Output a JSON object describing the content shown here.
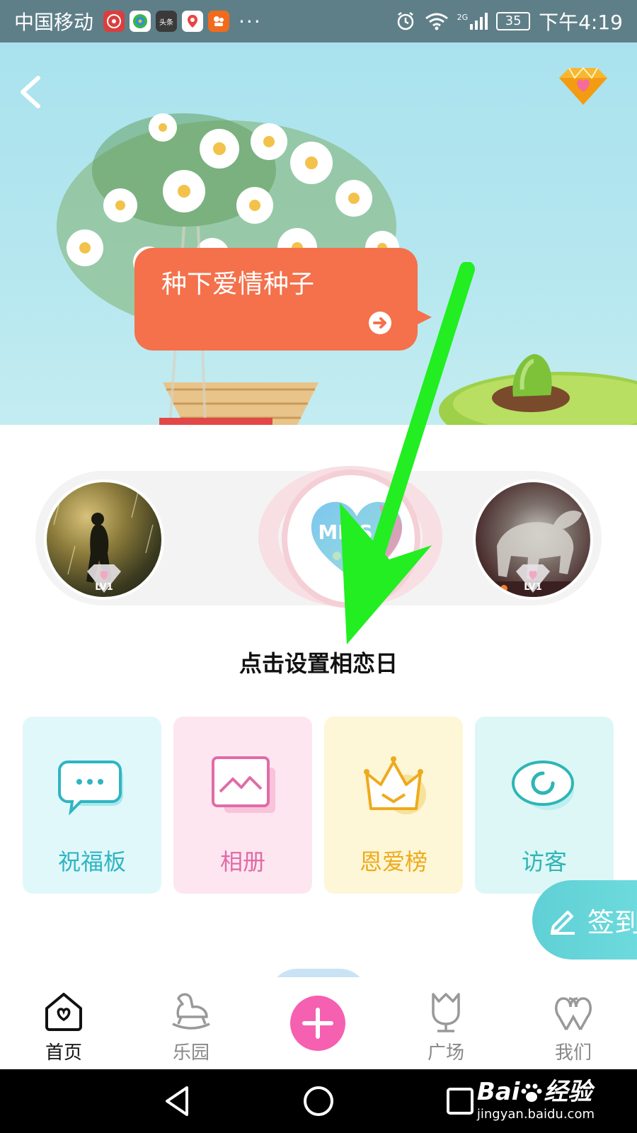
{
  "status_bar": {
    "carrier": "中国移动",
    "app_icons": [
      {
        "name": "app-icon-1",
        "color": "#d93f3f",
        "text": ""
      },
      {
        "name": "app-icon-2",
        "color": "#ffffff",
        "text": ""
      },
      {
        "name": "toutiao-icon",
        "color": "#3a3a3a",
        "text": "头条"
      },
      {
        "name": "app-icon-4",
        "color": "#e84545",
        "text": ""
      },
      {
        "name": "app-icon-5",
        "color": "#f26b1d",
        "text": ""
      }
    ],
    "more": "···",
    "network": "2G",
    "battery": "35",
    "time": "下午4:19"
  },
  "hero": {
    "bubble_text": "种下爱情种子",
    "colors": {
      "sky": "#a9e2ee",
      "bubble": "#f4714b"
    }
  },
  "couple": {
    "left_level": "LV1",
    "right_level": "LV1",
    "center_text": "MISS"
  },
  "anniversary_label": "点击设置相恋日",
  "features": [
    {
      "label": "祝福板",
      "icon": "chat-bubble-icon",
      "color": "#2fb5c2"
    },
    {
      "label": "相册",
      "icon": "photo-album-icon",
      "color": "#e06ca7"
    },
    {
      "label": "恩爱榜",
      "icon": "crown-icon",
      "color": "#eeaa1c"
    },
    {
      "label": "访客",
      "icon": "eye-icon",
      "color": "#2fb5b5"
    }
  ],
  "checkin_label": "签到",
  "tabs": {
    "home": "首页",
    "park": "乐园",
    "square": "广场",
    "us": "我们"
  },
  "watermark": {
    "main": "Bai",
    "main2": "经验",
    "sub": "jingyan.baidu.com"
  },
  "annotation_color": "#22ee22",
  "accent_pink": "#f560b1"
}
